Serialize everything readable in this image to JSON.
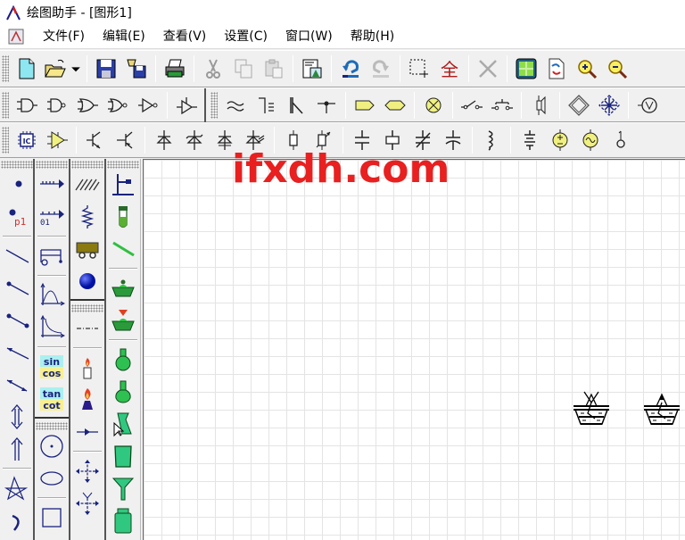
{
  "window": {
    "title": "绘图助手 - [图形1]",
    "app_icon": "app-logo-icon"
  },
  "menubar": {
    "doc_icon": "document-icon",
    "items": [
      {
        "label": "文件(F)"
      },
      {
        "label": "编辑(E)"
      },
      {
        "label": "查看(V)"
      },
      {
        "label": "设置(C)"
      },
      {
        "label": "窗口(W)"
      },
      {
        "label": "帮助(H)"
      }
    ]
  },
  "toolbar_standard": [
    "new-file-icon",
    "open-folder-icon",
    "dropdown-arrow-icon",
    "save-icon",
    "save-as-icon",
    "print-icon",
    "cut-icon",
    "copy-icon",
    "paste-icon",
    "insert-image-icon",
    "undo-icon",
    "redo-icon",
    "select-region-icon",
    "select-all-icon",
    "delete-icon",
    "fit-page-icon",
    "refresh-page-icon",
    "zoom-in-icon",
    "zoom-out-icon"
  ],
  "toolbar_logic": [
    "and-gate-icon",
    "nand-gate-icon",
    "or-gate-icon",
    "nor-gate-icon",
    "not-gate-icon",
    "tristate-buffer-icon",
    "filter-icon",
    "ground-transformer-icon",
    "antenna-icon",
    "probe-icon",
    "pentagon-icon",
    "hexagon-icon",
    "lamp-icon",
    "switch-icon",
    "push-button-icon",
    "speaker-icon",
    "bridge-rectifier-icon",
    "led-bridge-icon",
    "voltmeter-icon"
  ],
  "toolbar_components": [
    "ic-chip-icon",
    "op-amp-icon",
    "npn-transistor-icon",
    "pnp-transistor-icon",
    "diode-icon",
    "zener-diode-icon",
    "led-diode-icon",
    "photo-diode-icon",
    "resistor-icon",
    "variable-resistor-icon",
    "capacitor-icon",
    "electrolytic-capacitor-icon",
    "variable-capacitor-icon",
    "polar-capacitor-icon",
    "inductor-icon",
    "battery-icon",
    "dc-source-icon",
    "ac-source-icon",
    "terminal-icon"
  ],
  "palette": {
    "col1": [
      "point-icon",
      "labeled-point-icon",
      "line-icon",
      "ray-icon",
      "segment-icon",
      "vector-icon",
      "double-arrow-icon",
      "up-down-arrow-icon",
      "up-arrow-icon",
      "star-polygon-icon",
      "arc-icon"
    ],
    "col2": [
      "number-axis-icon",
      "number-axis-labeled-icon",
      "cart-icon",
      "parabola-graph-icon",
      "inverse-graph-icon",
      "sin-cos-icon",
      "tan-cot-icon",
      "circle-icon",
      "ellipse-icon",
      "rectangle-icon"
    ],
    "col3": [
      "hatch-icon",
      "spring-icon",
      "trolley-icon",
      "ball-icon",
      "dashed-line-icon",
      "candle-icon",
      "alcohol-lamp-icon",
      "arrow-line-icon",
      "force-cross-icon",
      "force-fork-icon"
    ],
    "col4": [
      "iron-stand-icon",
      "test-tube-icon",
      "glass-rod-icon",
      "evaporating-dish-icon",
      "funnel-stand-icon",
      "round-flask-icon",
      "flat-flask-icon",
      "conical-beaker-icon",
      "beaker-icon",
      "funnel-icon",
      "jar-icon"
    ]
  },
  "palette_text": {
    "p1": "p1",
    "sin": "sin",
    "cos": "cos",
    "tan": "tan",
    "cot": "cot",
    "axis01": "01"
  },
  "watermark": "ifxdh.com",
  "canvas_shapes": [
    {
      "name": "evaporating-dish-with-tripod-1"
    },
    {
      "name": "evaporating-dish-with-tripod-2"
    }
  ],
  "colors": {
    "watermark": "#e82020",
    "icon_blue": "#1a237e",
    "chem_green": "#22c55e"
  }
}
